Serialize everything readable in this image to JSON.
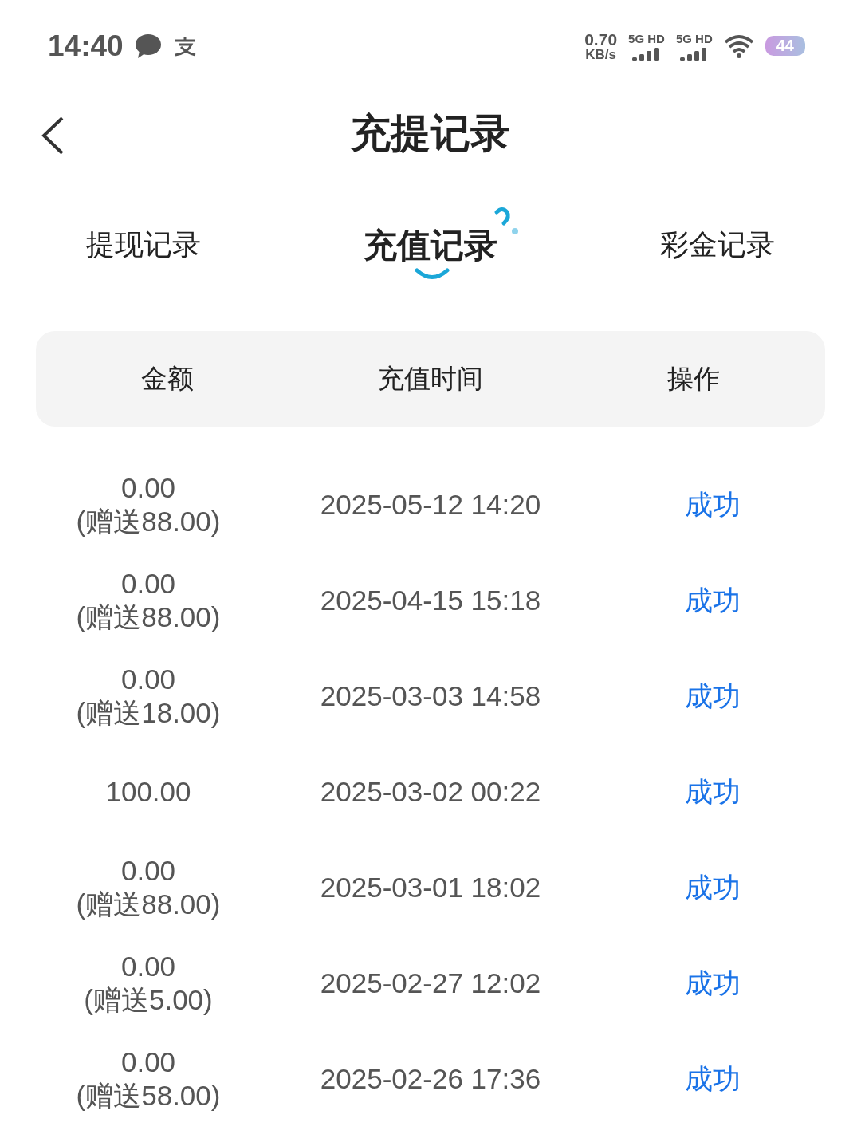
{
  "status_bar": {
    "time": "14:40",
    "speed": "0.70",
    "speed_unit": "KB/s",
    "sim_labels": [
      "5G HD",
      "5G HD"
    ],
    "battery": "44"
  },
  "header": {
    "title": "充提记录"
  },
  "tabs": [
    {
      "label": "提现记录",
      "selected": false
    },
    {
      "label": "充值记录",
      "selected": true
    },
    {
      "label": "彩金记录",
      "selected": false
    }
  ],
  "table": {
    "columns": [
      "金额",
      "充值时间",
      "操作"
    ],
    "rows": [
      {
        "amount": "0.00",
        "bonus": "(赠送88.00)",
        "time": "2025-05-12 14:20",
        "status": "成功"
      },
      {
        "amount": "0.00",
        "bonus": "(赠送88.00)",
        "time": "2025-04-15 15:18",
        "status": "成功"
      },
      {
        "amount": "0.00",
        "bonus": "(赠送18.00)",
        "time": "2025-03-03 14:58",
        "status": "成功"
      },
      {
        "amount": "100.00",
        "time": "2025-03-02 00:22",
        "status": "成功"
      },
      {
        "amount": "0.00",
        "bonus": "(赠送88.00)",
        "time": "2025-03-01 18:02",
        "status": "成功"
      },
      {
        "amount": "0.00",
        "bonus": "(赠送5.00)",
        "time": "2025-02-27 12:02",
        "status": "成功"
      },
      {
        "amount": "0.00",
        "bonus": "(赠送58.00)",
        "time": "2025-02-26 17:36",
        "status": "成功"
      }
    ]
  }
}
